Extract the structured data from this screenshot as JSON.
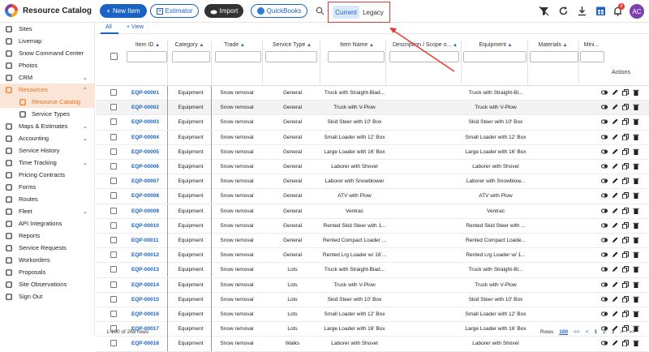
{
  "header": {
    "title": "Resource Catalog",
    "new_item": "New Item",
    "estimator": "Estimator",
    "import": "Import",
    "quickbooks": "QuickBooks",
    "toggle": {
      "current": "Current",
      "legacy": "Legacy"
    },
    "notification_count": "8",
    "avatar": "AC"
  },
  "sidebar": {
    "items": [
      {
        "label": "Sites",
        "icon": "building-icon"
      },
      {
        "label": "Livemap",
        "icon": "map-icon"
      },
      {
        "label": "Snow Command Center",
        "icon": "snowflake-icon"
      },
      {
        "label": "Photos",
        "icon": "photo-icon"
      },
      {
        "label": "CRM",
        "icon": "people-icon"
      },
      {
        "label": "Resources",
        "icon": "briefcase-icon"
      },
      {
        "label": "Resource Catalog",
        "icon": "folder-icon"
      },
      {
        "label": "Service Types",
        "icon": "list-icon"
      },
      {
        "label": "Maps & Estimates",
        "icon": "map-icon"
      },
      {
        "label": "Accounting",
        "icon": "calculator-icon"
      },
      {
        "label": "Service History",
        "icon": "user-icon"
      },
      {
        "label": "Time Tracking",
        "icon": "clock-icon"
      },
      {
        "label": "Pricing Contracts",
        "icon": "contract-icon"
      },
      {
        "label": "Forms",
        "icon": "form-icon"
      },
      {
        "label": "Routes",
        "icon": "route-icon"
      },
      {
        "label": "Fleet",
        "icon": "truck-icon"
      },
      {
        "label": "API Integrations",
        "icon": "link-icon"
      },
      {
        "label": "Reports",
        "icon": "report-icon"
      },
      {
        "label": "Service Requests",
        "icon": "request-icon"
      },
      {
        "label": "Workorders",
        "icon": "workorder-icon"
      },
      {
        "label": "Proposals",
        "icon": "proposal-icon"
      },
      {
        "label": "Site Observations",
        "icon": "eye-icon"
      },
      {
        "label": "Sign Out",
        "icon": "signout-icon"
      }
    ]
  },
  "tabs": {
    "all": "All",
    "view": "View"
  },
  "table": {
    "columns": [
      "Item ID",
      "Category",
      "Trade",
      "Service Type",
      "Item Name",
      "Description / Scope o...",
      "Equipment",
      "Materials",
      "Mini..."
    ],
    "actions": "Actions",
    "rows": [
      [
        "EQP-00001",
        "Equipment",
        "Snow removal",
        "General",
        "Truck with Straight-Blad...",
        "Truck with Straight-Bl..."
      ],
      [
        "EQP-00002",
        "Equipment",
        "Snow removal",
        "General",
        "Truck with V-Plow",
        "Truck with V-Plow"
      ],
      [
        "EQP-00003",
        "Equipment",
        "Snow removal",
        "General",
        "Skid Steer with 10' Box",
        "Skid Steer with 10' Box"
      ],
      [
        "EQP-00004",
        "Equipment",
        "Snow removal",
        "General",
        "Small Loader with 12' Box",
        "Small Loader with 12' Box"
      ],
      [
        "EQP-00005",
        "Equipment",
        "Snow removal",
        "General",
        "Large Loader with 16' Box",
        "Large Loader with 16' Box"
      ],
      [
        "EQP-00006",
        "Equipment",
        "Snow removal",
        "General",
        "Laborer with Shovel",
        "Laborer with Shovel"
      ],
      [
        "EQP-00007",
        "Equipment",
        "Snow removal",
        "General",
        "Laborer with Snowblower",
        "Laborer with Snowblow..."
      ],
      [
        "EQP-00008",
        "Equipment",
        "Snow removal",
        "General",
        "ATV with Plow",
        "ATV with Plow"
      ],
      [
        "EQP-00009",
        "Equipment",
        "Snow removal",
        "General",
        "Ventrac",
        "Ventrac"
      ],
      [
        "EQP-00010",
        "Equipment",
        "Snow removal",
        "General",
        "Rented Skid Steer with 1...",
        "Rented Skid Steer with ..."
      ],
      [
        "EQP-00011",
        "Equipment",
        "Snow removal",
        "General",
        "Rented Compact Loader ...",
        "Rented Compact Loade..."
      ],
      [
        "EQP-00012",
        "Equipment",
        "Snow removal",
        "General",
        "Rented Lrg Loader w/ 16'...",
        "Rented Lrg Loader w/ 1..."
      ],
      [
        "EQP-00013",
        "Equipment",
        "Snow removal",
        "Lots",
        "Truck with Straight-Blad...",
        "Truck with Straight-Bl..."
      ],
      [
        "EQP-00014",
        "Equipment",
        "Snow removal",
        "Lots",
        "Truck with V-Plow",
        "Truck with V-Plow"
      ],
      [
        "EQP-00015",
        "Equipment",
        "Snow removal",
        "Lots",
        "Skid Steer with 10' Box",
        "Skid Steer with 10' Box"
      ],
      [
        "EQP-00016",
        "Equipment",
        "Snow removal",
        "Lots",
        "Small Loader with 12' Box",
        "Small Loader with 12' Box"
      ],
      [
        "EQP-00017",
        "Equipment",
        "Snow removal",
        "Lots",
        "Large Loader with 16' Box",
        "Large Loader with 16' Box"
      ],
      [
        "EQP-00018",
        "Equipment",
        "Snow removal",
        "Walks",
        "Laborer with Shovel",
        "Laborer with Shovel"
      ]
    ]
  },
  "footer": {
    "range": "1-100 of 269 rows",
    "rows_label": "Rows",
    "per_page": "100",
    "pages": [
      "1",
      "2",
      "3"
    ],
    "first": "<<",
    "prev": "<",
    "next": ">",
    "last": ">>"
  },
  "colors": {
    "brand": "#1a63c5",
    "accent": "#e9731c",
    "highlight_box": "#e53935"
  }
}
